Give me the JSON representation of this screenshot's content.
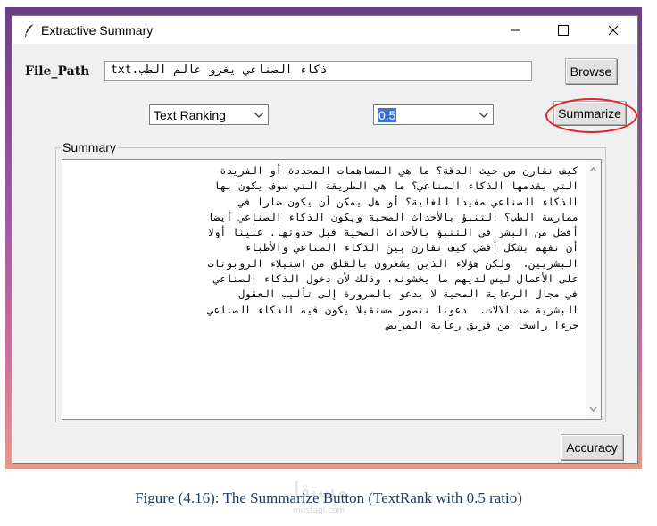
{
  "window": {
    "title": "Extractive Summary",
    "title_icon": "feather-icon",
    "controls": [
      "minimize-icon",
      "maximize-icon",
      "close-icon"
    ]
  },
  "file_path": {
    "label": "File_Path",
    "value": "ذكاء الصناعي يغزو عالم الطب.txt",
    "browse_label": "Browse"
  },
  "method_select": {
    "selected": "Text Ranking"
  },
  "ratio_select": {
    "selected": "0.5"
  },
  "summarize_label": "Summarize",
  "summary": {
    "group_label": "Summary",
    "lines": [
      "كيف نقارن من حيث الدقة؟ ما هي المساهمات المحددة أو الفريدة",
      "التي يقدمها الذكاء الصناعي؟ ما هي الطريقة التي سوف يكون بها",
      "الذكاء الصناعي مفيدا للغاية؟ أو هل يمكن أن يكون ضارا في",
      "ممارسة الطب؟ التنبؤ بالأحداث الصحية ويكون الذكاء الصناعي أيضا",
      "أفضل من البشر في التنبؤ بالأحداث الصحية قبل حدوثها. علينا أولا",
      "أن نفهم بشكل أفضل كيف نقارن بين الذكاء الصناعي والأطباء",
      "البشريين.  ولكن هؤلاء الذين يشعرون بالقلق من استيلاء الروبوتات",
      "على الأعمال ليس لديهم ما يخشونه، وذلك لأن دخول الذكاء الصناعي",
      "في مجال الرعاية الصحية لا يدعو بالضرورة إلى تأليب العقول",
      "البشرية ضد الآلات.  دعونا نتصور مستقبلا يكون فيه الذكاء الصناعي",
      "جزءا راسخا من فريق رعاية المريض"
    ]
  },
  "accuracy_label": "Accuracy",
  "caption": "Figure (4.16): The Summarize Button (TextRank with 0.5 ratio)",
  "watermark": {
    "main": "مستقل",
    "sub": "mostaql.com"
  },
  "colors": {
    "highlight": "#e02424",
    "selection": "#3b73d7",
    "caption": "#1f3864"
  }
}
